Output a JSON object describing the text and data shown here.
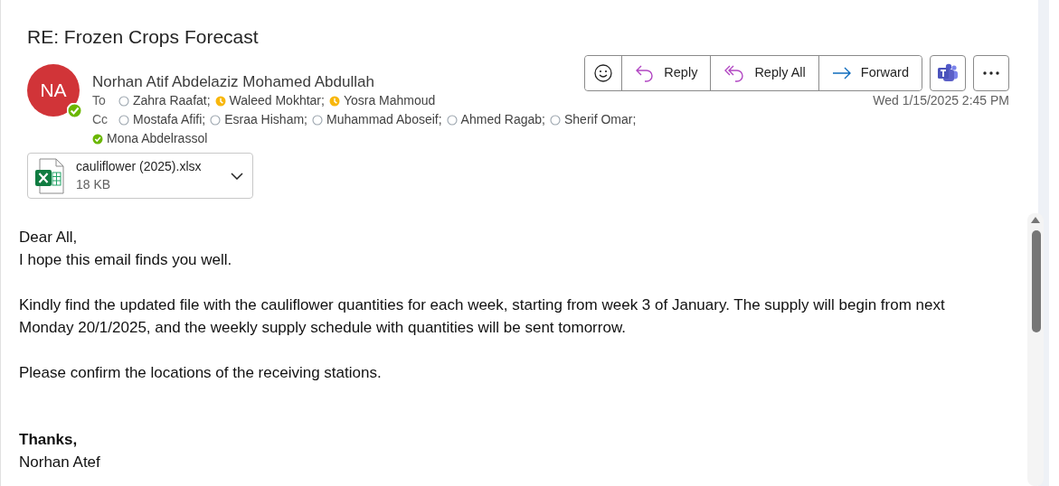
{
  "subject": "RE: Frozen Crops Forecast",
  "sender": {
    "initials": "NA",
    "name": "Norhan Atif Abdelaziz Mohamed Abdullah",
    "kind": "available"
  },
  "to": {
    "label": "To",
    "recipients": [
      {
        "name": "Zahra Raafat;",
        "kind": "offline"
      },
      {
        "name": "Waleed Mokhtar;",
        "kind": "away"
      },
      {
        "name": "Yosra Mahmoud",
        "kind": "away"
      }
    ]
  },
  "cc": {
    "label": "Cc",
    "recipients": [
      {
        "name": "Mostafa Afifi;",
        "kind": "offline"
      },
      {
        "name": "Esraa Hisham;",
        "kind": "offline"
      },
      {
        "name": "Muhammad Aboseif;",
        "kind": "offline"
      },
      {
        "name": "Ahmed Ragab;",
        "kind": "offline"
      },
      {
        "name": "Sherif Omar;",
        "kind": "offline"
      },
      {
        "name": "Mona Abdelrassol",
        "kind": "available"
      }
    ]
  },
  "actions": [
    {
      "kind": "react"
    },
    {
      "kind": "reply",
      "label": "Reply"
    },
    {
      "kind": "reply-all",
      "label": "Reply All"
    },
    {
      "kind": "forward",
      "label": "Forward"
    }
  ],
  "date": "Wed 1/15/2025 2:45 PM",
  "attachment": {
    "name": "cauliflower (2025).xlsx",
    "size": "18 KB"
  },
  "body": [
    {
      "lines": [
        "Dear All,",
        "I hope this email finds you well."
      ]
    },
    {
      "lines": [
        "Kindly find the updated file with the cauliflower quantities for each week, starting from week 3 of January. The supply will begin from next Monday 20/1/2025, and the weekly supply schedule with quantities will be sent tomorrow."
      ]
    },
    {
      "lines": [
        "Please confirm the locations of the receiving stations."
      ]
    }
  ],
  "signature": {
    "closing": "Thanks,",
    "name": "Norhan Atef"
  }
}
